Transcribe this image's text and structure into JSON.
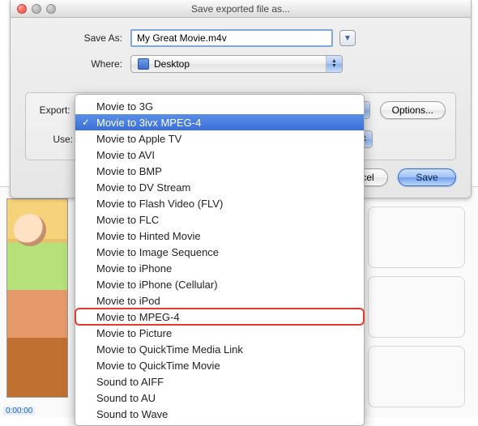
{
  "window": {
    "title": "Save exported file as..."
  },
  "form": {
    "save_as_label": "Save As:",
    "filename": "My Great Movie.m4v",
    "where_label": "Where:",
    "where_value": "Desktop"
  },
  "export": {
    "export_label": "Export:",
    "use_label": "Use:",
    "selected": "Movie to 3ivx MPEG-4",
    "options_label": "Options..."
  },
  "buttons": {
    "cancel": "Cancel",
    "save": "Save"
  },
  "menu": {
    "items": [
      "Movie to 3G",
      "Movie to 3ivx MPEG-4",
      "Movie to Apple TV",
      "Movie to AVI",
      "Movie to BMP",
      "Movie to DV Stream",
      "Movie to Flash Video (FLV)",
      "Movie to FLC",
      "Movie to Hinted Movie",
      "Movie to Image Sequence",
      "Movie to iPhone",
      "Movie to iPhone (Cellular)",
      "Movie to iPod",
      "Movie to MPEG-4",
      "Movie to Picture",
      "Movie to QuickTime Media Link",
      "Movie to QuickTime Movie",
      "Sound to AIFF",
      "Sound to AU",
      "Sound to Wave"
    ],
    "selected_index": 1,
    "highlighted_index": 13
  },
  "background": {
    "timecode": "0:00:00"
  }
}
